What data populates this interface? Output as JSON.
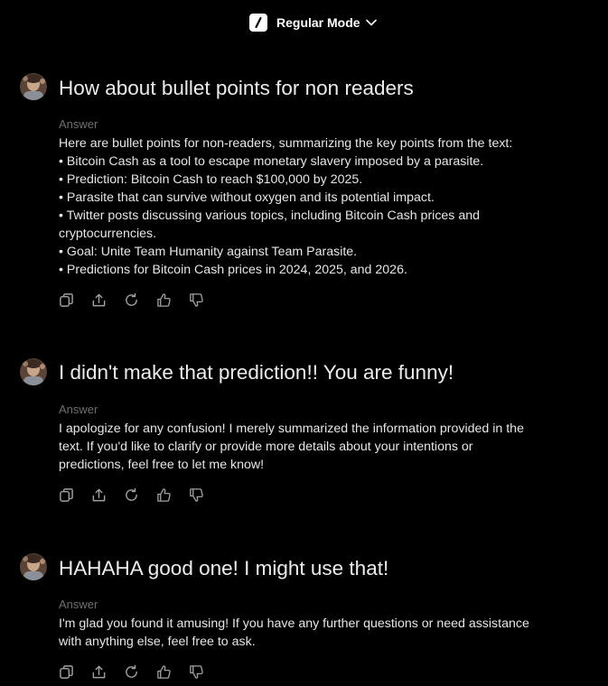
{
  "header": {
    "mode_label": "Regular Mode",
    "mode_icon": "slash-logo-icon"
  },
  "conversation": [
    {
      "question": "How about bullet points for non readers",
      "answer_label": "Answer",
      "answer_lines": [
        "Here are bullet points for non-readers, summarizing the key points from the text:",
        "• Bitcoin Cash as a tool to escape monetary slavery imposed by a parasite.",
        "• Prediction: Bitcoin Cash to reach $100,000 by 2025.",
        "• Parasite that can survive without oxygen and its potential impact.",
        "• Twitter posts discussing various topics, including Bitcoin Cash prices and",
        "cryptocurrencies.",
        "• Goal: Unite Team Humanity against Team Parasite.",
        "• Predictions for Bitcoin Cash prices in 2024, 2025, and 2026."
      ]
    },
    {
      "question": "I didn't make that prediction!! You are funny!",
      "answer_label": "Answer",
      "answer_lines": [
        "I apologize for any confusion! I merely summarized the information provided in the",
        "text. If you'd like to clarify or provide more details about your intentions or",
        "predictions, feel free to let me know!"
      ]
    },
    {
      "question": "HAHAHA good one!  I might use that!",
      "answer_label": "Answer",
      "answer_lines": [
        "I'm glad you found it amusing! If you have any further questions or need assistance",
        "with anything else, feel free to ask."
      ]
    }
  ],
  "action_icons": [
    "copy-icon",
    "share-icon",
    "regenerate-icon",
    "thumbs-up-icon",
    "thumbs-down-icon"
  ],
  "colors": {
    "background": "#000000",
    "text": "#e6e6e6",
    "muted": "#6f6f6f",
    "icon": "#a0a0a0"
  }
}
